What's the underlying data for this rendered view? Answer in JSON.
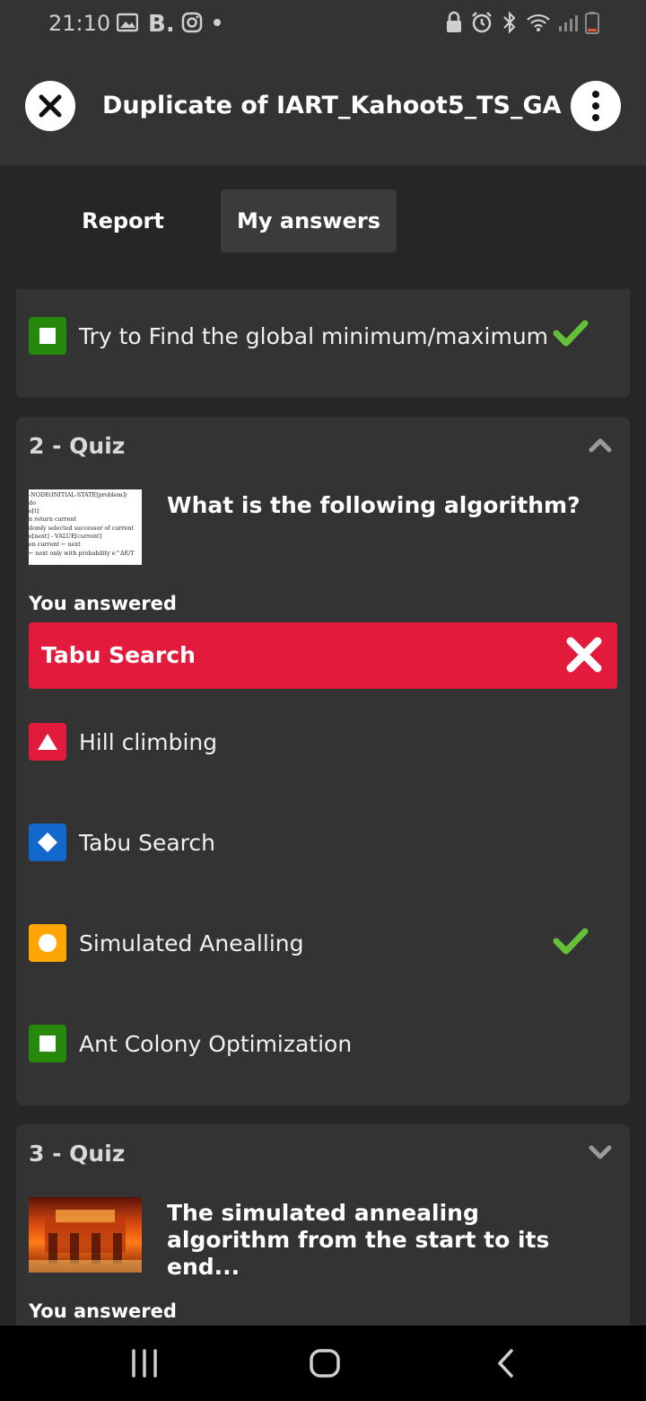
{
  "status_bar": {
    "time": "21:10",
    "left_icons": [
      "gallery-icon",
      "b-app-icon",
      "instagram-icon",
      "dot-icon"
    ],
    "right_icons": [
      "lock-icon",
      "alarm-icon",
      "bluetooth-icon",
      "wifi-icon",
      "signal-icon",
      "battery-icon"
    ]
  },
  "header": {
    "title": "Duplicate of IART_Kahoot5_TS_GA"
  },
  "tabs": [
    {
      "label": "Report",
      "active": false
    },
    {
      "label": "My answers",
      "active": true
    }
  ],
  "card1": {
    "option": {
      "shape": "square",
      "color": "#26890c",
      "text": "Try to Find the global minimum/maximum",
      "correct": true
    }
  },
  "card2": {
    "title": "2 - Quiz",
    "question": "What is the following algorithm?",
    "you_answered_label": "You answered",
    "answer": "Tabu Search",
    "answer_color": "#e21b3c",
    "options": [
      {
        "shape": "triangle",
        "color": "#e21b3c",
        "text": "Hill climbing",
        "correct": false
      },
      {
        "shape": "diamond",
        "color": "#1368ce",
        "text": "Tabu Search",
        "correct": false
      },
      {
        "shape": "circle",
        "color": "#ffa602",
        "text": "Simulated Anealling",
        "correct": true
      },
      {
        "shape": "square",
        "color": "#26890c",
        "text": "Ant Colony Optimization",
        "correct": false
      }
    ],
    "thumbnail_lines": [
      "-NODE(INITIAL-STATE[problem])",
      "do",
      "e[t]",
      "n return current",
      "domly selected successor of current",
      "e[next] - VALUE[current]",
      "en current ← next",
      "← next only with probability e^ΔE/T"
    ]
  },
  "card3": {
    "title": "3 - Quiz",
    "question": "The simulated annealing algorithm from the start to its end...",
    "you_answered_label": "You answered"
  },
  "colors": {
    "background": "#262626",
    "card": "#333333",
    "correct": "#66bf39",
    "wrong": "#e21b3c"
  }
}
